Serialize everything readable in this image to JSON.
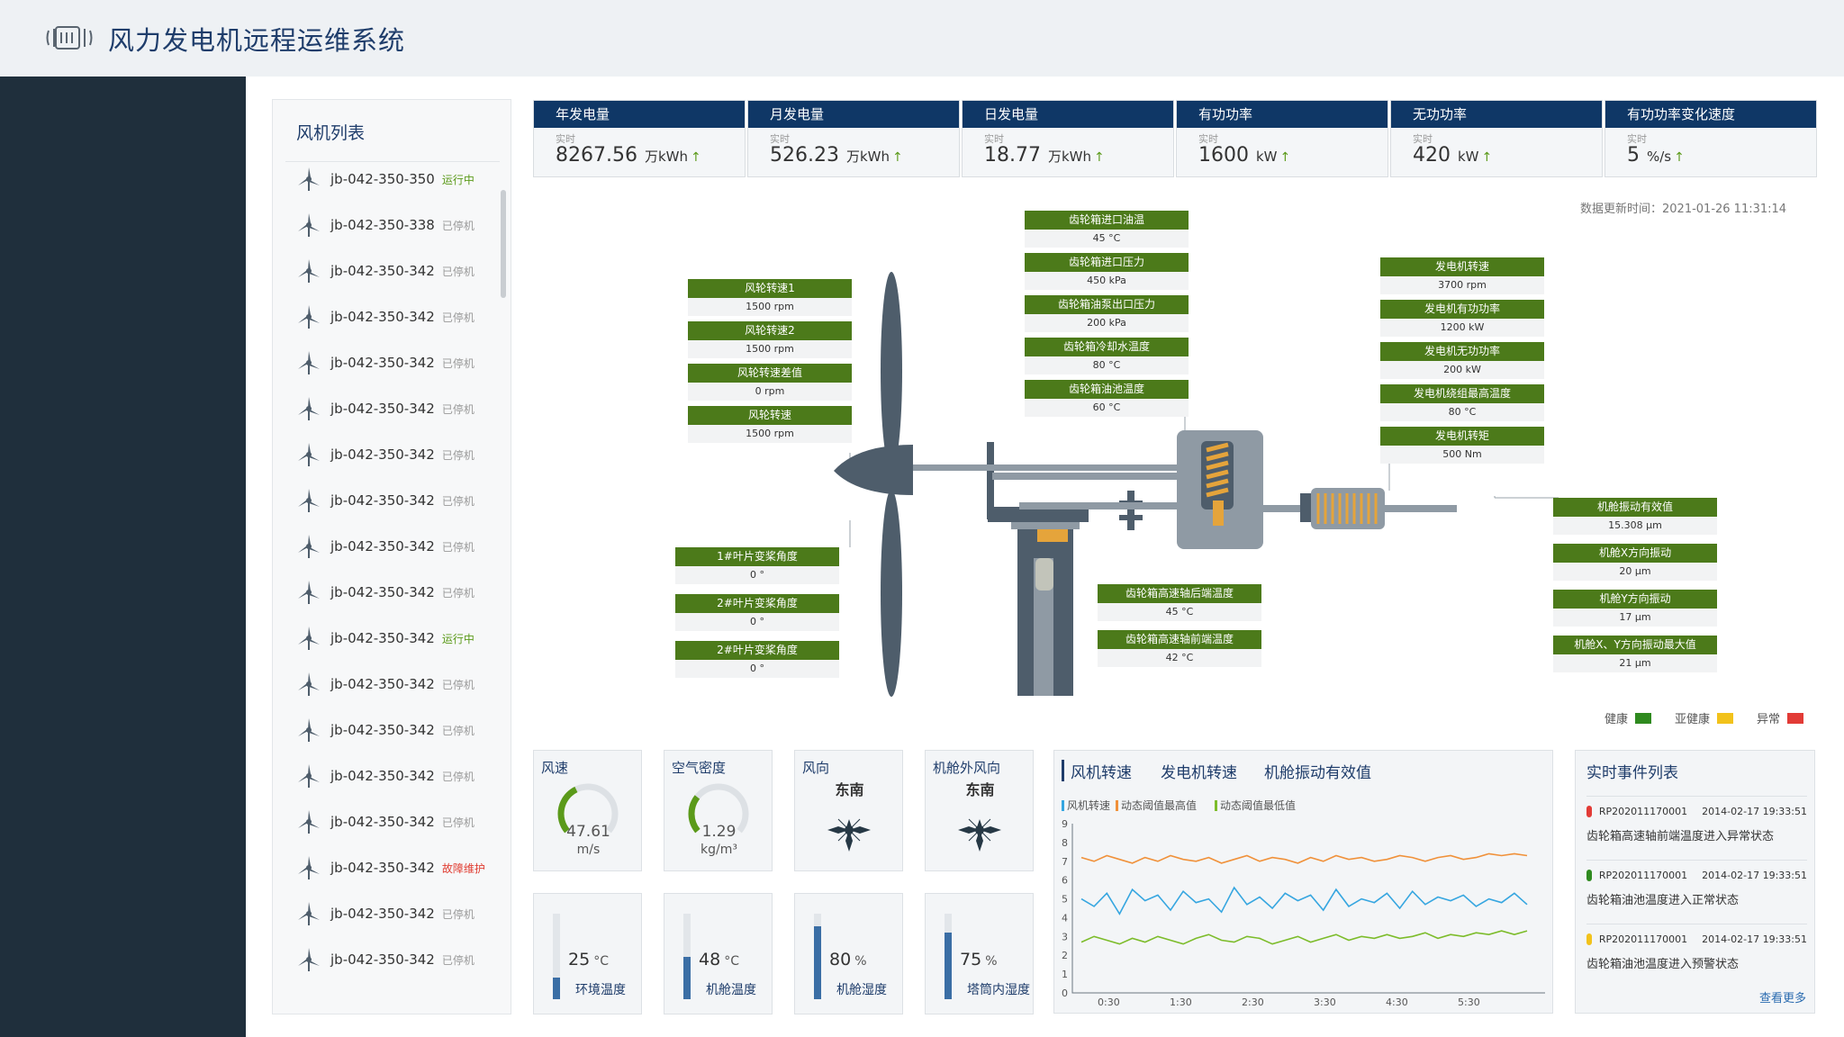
{
  "app": {
    "title": "风力发电机远程运维系统"
  },
  "turbine_list": {
    "title": "风机列表",
    "items": [
      {
        "name": "jb-042-350-350",
        "status": "运行中",
        "state": "run"
      },
      {
        "name": "jb-042-350-338",
        "status": "已停机",
        "state": "stop"
      },
      {
        "name": "jb-042-350-342",
        "status": "已停机",
        "state": "stop"
      },
      {
        "name": "jb-042-350-342",
        "status": "已停机",
        "state": "stop"
      },
      {
        "name": "jb-042-350-342",
        "status": "已停机",
        "state": "stop"
      },
      {
        "name": "jb-042-350-342",
        "status": "已停机",
        "state": "stop"
      },
      {
        "name": "jb-042-350-342",
        "status": "已停机",
        "state": "stop"
      },
      {
        "name": "jb-042-350-342",
        "status": "已停机",
        "state": "stop"
      },
      {
        "name": "jb-042-350-342",
        "status": "已停机",
        "state": "stop"
      },
      {
        "name": "jb-042-350-342",
        "status": "已停机",
        "state": "stop"
      },
      {
        "name": "jb-042-350-342",
        "status": "运行中",
        "state": "run"
      },
      {
        "name": "jb-042-350-342",
        "status": "已停机",
        "state": "stop"
      },
      {
        "name": "jb-042-350-342",
        "status": "已停机",
        "state": "stop"
      },
      {
        "name": "jb-042-350-342",
        "status": "已停机",
        "state": "stop"
      },
      {
        "name": "jb-042-350-342",
        "status": "已停机",
        "state": "stop"
      },
      {
        "name": "jb-042-350-342",
        "status": "故障维护",
        "state": "fault"
      },
      {
        "name": "jb-042-350-342",
        "status": "已停机",
        "state": "stop"
      },
      {
        "name": "jb-042-350-342",
        "status": "已停机",
        "state": "stop"
      }
    ]
  },
  "metrics": [
    {
      "title": "年发电量",
      "sub": "实时",
      "value": "8267.56",
      "unit": "万kWh",
      "arrow": "↑"
    },
    {
      "title": "月发电量",
      "sub": "实时",
      "value": "526.23",
      "unit": "万kWh",
      "arrow": "↑"
    },
    {
      "title": "日发电量",
      "sub": "实时",
      "value": "18.77",
      "unit": "万kWh",
      "arrow": "↑"
    },
    {
      "title": "有功功率",
      "sub": "实时",
      "value": "1600",
      "unit": "kW",
      "arrow": "↑"
    },
    {
      "title": "无功功率",
      "sub": "实时",
      "value": "420",
      "unit": "kW",
      "arrow": "↑"
    },
    {
      "title": "有功功率变化速度",
      "sub": "实时",
      "value": "5",
      "unit": "%/s",
      "arrow": "↑"
    }
  ],
  "update_time": "数据更新时间：2021-01-26 11:31:14",
  "sensors": {
    "rotor": [
      {
        "label": "风轮转速1",
        "value": "1500 rpm"
      },
      {
        "label": "风轮转速2",
        "value": "1500 rpm"
      },
      {
        "label": "风轮转速差值",
        "value": "0 rpm"
      },
      {
        "label": "风轮转速",
        "value": "1500 rpm"
      }
    ],
    "gearbox": [
      {
        "label": "齿轮箱进口油温",
        "value": "45 °C"
      },
      {
        "label": "齿轮箱进口压力",
        "value": "450 kPa"
      },
      {
        "label": "齿轮箱油泵出口压力",
        "value": "200 kPa"
      },
      {
        "label": "齿轮箱冷却水温度",
        "value": "80 °C"
      },
      {
        "label": "齿轮箱油池温度",
        "value": "60 °C"
      }
    ],
    "generator": [
      {
        "label": "发电机转速",
        "value": "3700 rpm"
      },
      {
        "label": "发电机有功功率",
        "value": "1200 kW"
      },
      {
        "label": "发电机无功功率",
        "value": "200 kW"
      },
      {
        "label": "发电机绕组最高温度",
        "value": "80 °C"
      },
      {
        "label": "发电机转矩",
        "value": "500 Nm"
      }
    ],
    "pitch": [
      {
        "label": "1#叶片变桨角度",
        "value": "0 °"
      },
      {
        "label": "2#叶片变桨角度",
        "value": "0 °"
      },
      {
        "label": "2#叶片变桨角度",
        "value": "0 °"
      }
    ],
    "bearing": [
      {
        "label": "齿轮箱高速轴后端温度",
        "value": "45 °C"
      },
      {
        "label": "齿轮箱高速轴前端温度",
        "value": "42 °C"
      }
    ],
    "vibration": [
      {
        "label": "机舱振动有效值",
        "value": "15.308 μm"
      },
      {
        "label": "机舱X方向振动",
        "value": "20 μm"
      },
      {
        "label": "机舱Y方向振动",
        "value": "17 μm"
      },
      {
        "label": "机舱X、Y方向振动最大值",
        "value": "21 μm"
      }
    ]
  },
  "legend": [
    {
      "label": "健康",
      "color": "#2f8a1f"
    },
    {
      "label": "亚健康",
      "color": "#f2c21b"
    },
    {
      "label": "异常",
      "color": "#e23b36"
    }
  ],
  "gauges": [
    {
      "title": "风速",
      "value": "47.61",
      "unit": "m/s",
      "fraction": 0.4
    },
    {
      "title": "空气密度",
      "value": "1.29",
      "unit": "kg/m³",
      "fraction": 0.3
    }
  ],
  "directions": [
    {
      "title": "风向",
      "value": "东南"
    },
    {
      "title": "机舱外风向",
      "value": "东南"
    }
  ],
  "bars": [
    {
      "value": "25",
      "unit": "°C",
      "label": "环境温度",
      "fraction": 0.25
    },
    {
      "value": "48",
      "unit": "°C",
      "label": "机舱温度",
      "fraction": 0.5
    },
    {
      "value": "80",
      "unit": "%",
      "label": "机舱湿度",
      "fraction": 0.85
    },
    {
      "value": "75",
      "unit": "%",
      "label": "塔筒内湿度",
      "fraction": 0.78
    }
  ],
  "chart": {
    "tabs": [
      "风机转速",
      "发电机转速",
      "机舱振动有效值"
    ],
    "legend": [
      {
        "label": "风机转速",
        "color": "#36a6e0"
      },
      {
        "label": "动态阈值最高值",
        "color": "#f0913a"
      },
      {
        "label": "动态阈值最低值",
        "color": "#7cbc2a"
      }
    ]
  },
  "chart_data": {
    "type": "line",
    "x_ticks": [
      "0:30",
      "1:30",
      "2:30",
      "3:30",
      "4:30",
      "5:30"
    ],
    "y_ticks": [
      "0",
      "1",
      "2",
      "3",
      "4",
      "5",
      "6",
      "7",
      "8",
      "9"
    ],
    "ylim": [
      0,
      9
    ],
    "series": [
      {
        "name": "风机转速",
        "values": [
          5.0,
          4.6,
          5.3,
          4.2,
          5.5,
          4.9,
          5.2,
          4.4,
          5.4,
          4.8,
          5.0,
          4.3,
          5.6,
          4.7,
          5.1,
          4.5,
          5.3,
          4.9,
          5.2,
          4.4,
          5.5,
          4.6,
          5.0,
          4.8,
          5.3,
          4.5,
          5.4,
          4.7,
          5.1,
          4.9,
          5.2,
          4.6,
          5.0,
          4.8,
          5.3,
          4.7
        ]
      },
      {
        "name": "动态阈值最高值",
        "values": [
          7.2,
          7.0,
          7.3,
          7.1,
          6.9,
          7.2,
          7.0,
          7.3,
          7.1,
          7.0,
          7.2,
          6.9,
          7.1,
          7.3,
          7.0,
          7.2,
          7.1,
          6.9,
          7.2,
          7.0,
          7.3,
          7.1,
          7.2,
          7.0,
          7.1,
          7.3,
          7.2,
          7.0,
          7.2,
          7.3,
          7.1,
          7.2,
          7.4,
          7.3,
          7.4,
          7.3
        ]
      },
      {
        "name": "动态阈值最低值",
        "values": [
          2.7,
          3.0,
          2.8,
          2.6,
          2.9,
          2.7,
          3.0,
          2.8,
          2.6,
          2.9,
          3.1,
          2.8,
          2.7,
          3.0,
          2.9,
          2.6,
          2.8,
          3.0,
          2.7,
          2.9,
          3.1,
          2.8,
          3.0,
          2.9,
          3.1,
          2.9,
          3.0,
          3.2,
          2.9,
          3.1,
          3.0,
          3.2,
          3.1,
          3.3,
          3.1,
          3.3
        ]
      }
    ]
  },
  "events": {
    "title": "实时事件列表",
    "items": [
      {
        "id": "RP202011170001",
        "time": "2014-02-17 19:33:51",
        "text": "齿轮箱高速轴前端温度进入异常状态",
        "color": "#e23b36"
      },
      {
        "id": "RP202011170001",
        "time": "2014-02-17 19:33:51",
        "text": "齿轮箱油池温度进入正常状态",
        "color": "#2f8a1f"
      },
      {
        "id": "RP202011170001",
        "time": "2014-02-17 19:33:51",
        "text": "齿轮箱油池温度进入预警状态",
        "color": "#f2c21b"
      }
    ],
    "more": "查看更多"
  }
}
